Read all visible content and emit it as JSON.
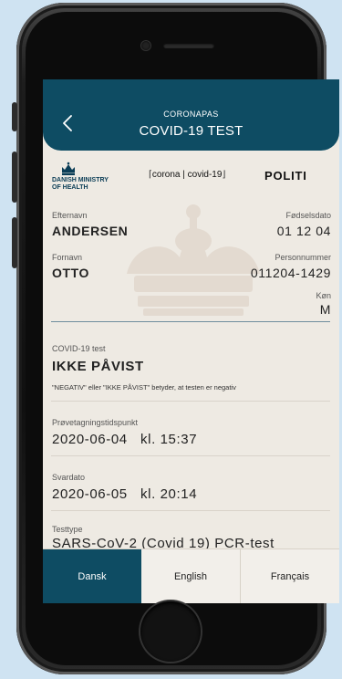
{
  "header": {
    "supertitle": "CORONAPAS",
    "title": "COVID-19 TEST"
  },
  "logos": {
    "ministry_line1": "DANISH MINISTRY",
    "ministry_line2": "OF HEALTH",
    "corona": "corona | covid-19",
    "politi": "POLITI"
  },
  "person": {
    "surname_label": "Efternavn",
    "surname": "ANDERSEN",
    "birthdate_label": "Fødselsdato",
    "birthdate": "01 12 04",
    "firstname_label": "Fornavn",
    "firstname": "OTTO",
    "cpr_label": "Personnummer",
    "cpr": "011204-1429",
    "sex_label": "Køn",
    "sex": "M"
  },
  "test": {
    "result_label": "COVID-19 test",
    "result": "IKKE PÅVIST",
    "note": "\"NEGATIV\" eller \"IKKE PÅVIST\" betyder, at testen er negativ",
    "sampling_label": "Prøvetagningstidspunkt",
    "sampling": "2020-06-04   kl. 15:37",
    "answer_label": "Svardato",
    "answer": "2020-06-05   kl. 20:14",
    "type_label": "Testtype",
    "type": "SARS-CoV-2 (Covid 19) PCR-test"
  },
  "tabs": [
    {
      "label": "Dansk",
      "active": true
    },
    {
      "label": "English",
      "active": false
    },
    {
      "label": "Français",
      "active": false
    }
  ],
  "colors": {
    "accent": "#0e4c63",
    "background": "#eeeae3",
    "page": "#cfe3f2"
  }
}
